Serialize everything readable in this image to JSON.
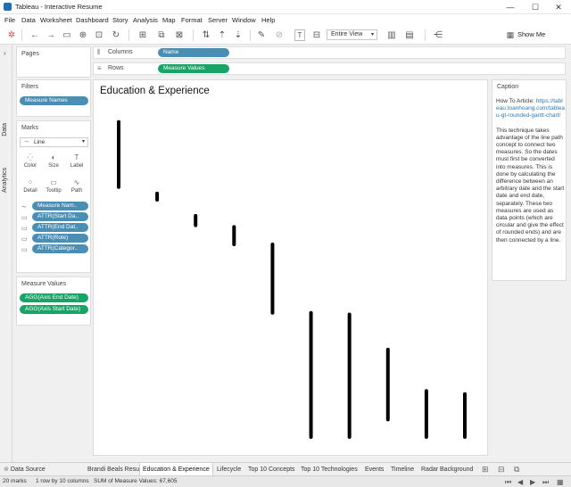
{
  "window": {
    "title": "Tableau - Interactive Resume",
    "min": "—",
    "max": "☐",
    "close": "✕"
  },
  "menu": [
    "File",
    "Data",
    "Worksheet",
    "Dashboard",
    "Story",
    "Analysis",
    "Map",
    "Format",
    "Server",
    "Window",
    "Help"
  ],
  "toolbar": {
    "view_select": "Entire View",
    "show_me": "Show Me"
  },
  "side_tabs": {
    "data": "Data",
    "analytics": "Analytics"
  },
  "pages": {
    "title": "Pages"
  },
  "filters": {
    "title": "Filters",
    "items": [
      "Measure Names"
    ]
  },
  "marks": {
    "title": "Marks",
    "type": "Line",
    "buttons": [
      {
        "label": "Color",
        "icon": "color-icon"
      },
      {
        "label": "Size",
        "icon": "size-icon"
      },
      {
        "label": "Label",
        "icon": "label-icon"
      },
      {
        "label": "Detail",
        "icon": "detail-icon"
      },
      {
        "label": "Tooltip",
        "icon": "tooltip-icon"
      },
      {
        "label": "Path",
        "icon": "path-icon"
      }
    ],
    "fields": [
      "Measure Nam..",
      "ATTR(Start Da..",
      "ATTR(End Dat..",
      "ATTR(Role)",
      "ATTR(Categor.."
    ]
  },
  "measure_values": {
    "title": "Measure Values",
    "items": [
      "AGG(Axis End Date)",
      "AGG(Axis Start Date)"
    ]
  },
  "shelves": {
    "columns_label": "Columns",
    "columns_pill": "Name",
    "rows_label": "Rows",
    "rows_pill": "Measure Values"
  },
  "viz": {
    "title": "Education & Experience"
  },
  "caption": {
    "title": "Caption",
    "link_prefix": "How To Article: ",
    "link_text": "https://tableau.toanhoang.com/tableau-gt-rounded-gantt-chart/",
    "body": "This technique takes advantage of the line path concept to connect two measures. So the dates must first be converted into measures. This is done by calculating the difference between an arbitrary date and the start date and end date, separately. These two measures are used as data points (which are circular and give the effect of rounded ends) and are then connected by a line."
  },
  "sheet_tabs": [
    "Data Source",
    "Brandi Beals Resume",
    "Education & Experience",
    "Lifecycle",
    "Top 10 Concepts",
    "Top 10 Technologies",
    "Events",
    "Timeline",
    "Radar Background"
  ],
  "active_tab": "Education & Experience",
  "status": {
    "marks": "20 marks",
    "rows": "1 row by 10 columns",
    "sum": "SUM of Measure Values: 67,605"
  },
  "colors": {
    "blue_pill": "#4a8eb3",
    "green_pill": "#17a466",
    "line": "#000000"
  },
  "chart_data": {
    "type": "gantt",
    "title": "Education & Experience",
    "bars": [
      {
        "start": 2,
        "end": 43
      },
      {
        "start": 47,
        "end": 51
      },
      {
        "start": 61,
        "end": 67
      },
      {
        "start": 68,
        "end": 79
      },
      {
        "start": 79,
        "end": 122
      },
      {
        "start": 122,
        "end": 200
      },
      {
        "start": 123,
        "end": 200
      },
      {
        "start": 145,
        "end": 189
      },
      {
        "start": 171,
        "end": 200
      },
      {
        "start": 173,
        "end": 200
      }
    ],
    "ylim": [
      0,
      200
    ]
  }
}
